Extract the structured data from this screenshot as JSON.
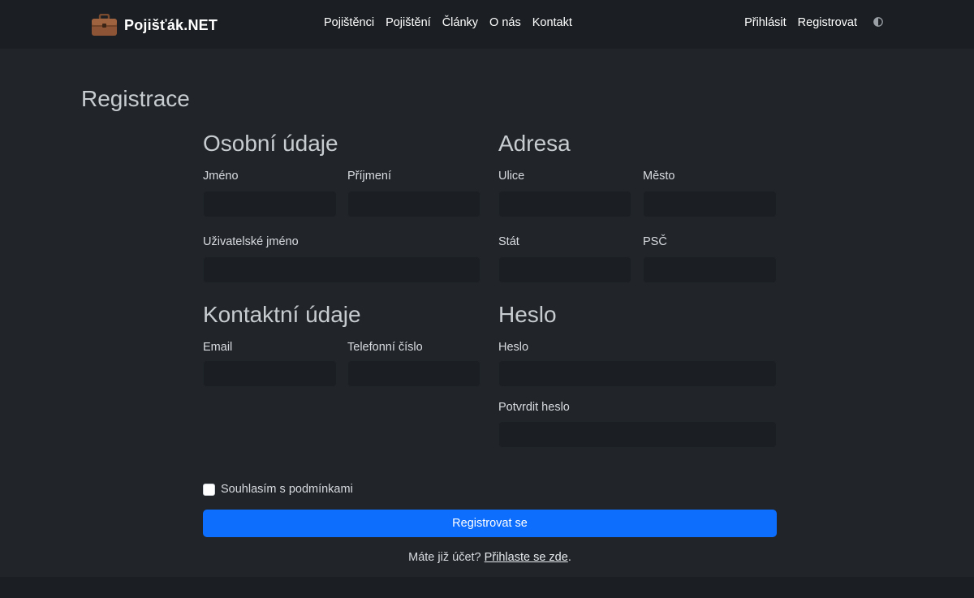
{
  "navbar": {
    "brand": "Pojišťák.NET",
    "links": [
      "Pojištěnci",
      "Pojištění",
      "Články",
      "O nás",
      "Kontakt"
    ],
    "login": "Přihlásit",
    "register": "Registrovat",
    "theme_icon": "half-circle-icon"
  },
  "page": {
    "title": "Registrace"
  },
  "sections": {
    "personal": {
      "title": "Osobní údaje",
      "first_name_label": "Jméno",
      "last_name_label": "Příjmení",
      "username_label": "Uživatelské jméno"
    },
    "address": {
      "title": "Adresa",
      "street_label": "Ulice",
      "city_label": "Město",
      "state_label": "Stát",
      "zip_label": "PSČ"
    },
    "contact": {
      "title": "Kontaktní údaje",
      "email_label": "Email",
      "phone_label": "Telefonní číslo"
    },
    "password": {
      "title": "Heslo",
      "password_label": "Heslo",
      "confirm_label": "Potvrdit heslo"
    }
  },
  "form": {
    "terms_label": "Souhlasím s podmínkami",
    "terms_checked": false,
    "submit_label": "Registrovat se",
    "login_prompt": "Máte již účet?",
    "login_link": "Přihlaste se zde",
    "login_suffix": "."
  },
  "colors": {
    "background": "#212529",
    "navbar": "#1b1f23",
    "primary": "#0d6efd",
    "input_bg": "#1b1f23"
  }
}
